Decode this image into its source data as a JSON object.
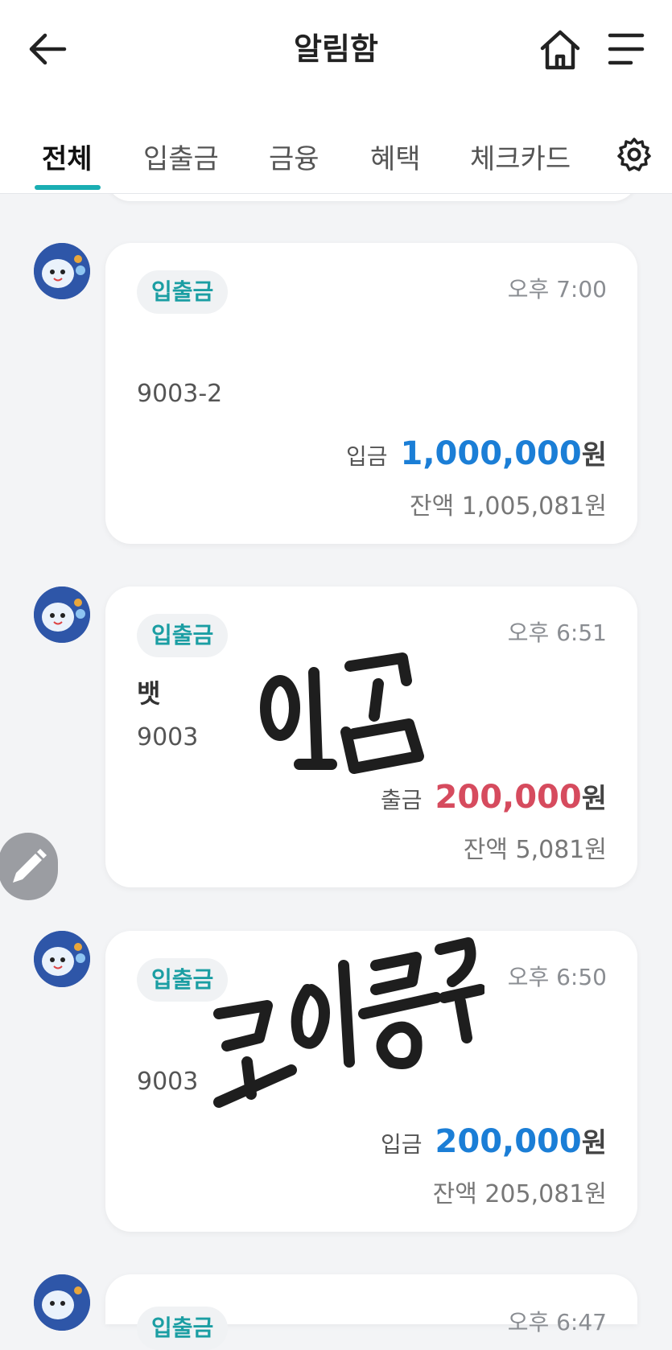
{
  "header": {
    "title": "알림함"
  },
  "tabs": [
    {
      "label": "전체",
      "active": true
    },
    {
      "label": "입출금",
      "active": false
    },
    {
      "label": "금융",
      "active": false
    },
    {
      "label": "혜택",
      "active": false
    },
    {
      "label": "체크카드",
      "active": false
    }
  ],
  "notifications": [
    {
      "badge": "입출금",
      "time": "오후 7:00",
      "title": "",
      "account": "9003-2",
      "kind": "입금",
      "amount": "1,000,000",
      "currency": "원",
      "balance": "잔액 1,005,081원"
    },
    {
      "badge": "입출금",
      "time": "오후 6:51",
      "title": "뱃",
      "account": "9003",
      "kind": "출금",
      "amount": "200,000",
      "currency": "원",
      "balance": "잔액 5,081원"
    },
    {
      "badge": "입출금",
      "time": "오후 6:50",
      "title": "",
      "account": "9003",
      "kind": "입금",
      "amount": "200,000",
      "currency": "원",
      "balance": "잔액 205,081원"
    },
    {
      "badge": "입출금",
      "time": "오후 6:47"
    }
  ],
  "colors": {
    "accent": "#1aaeb3",
    "deposit": "#1b7ed6",
    "withdrawal": "#d64b5e"
  },
  "icons": [
    "back-arrow-icon",
    "home-icon",
    "menu-icon",
    "gear-icon",
    "pencil-icon"
  ]
}
